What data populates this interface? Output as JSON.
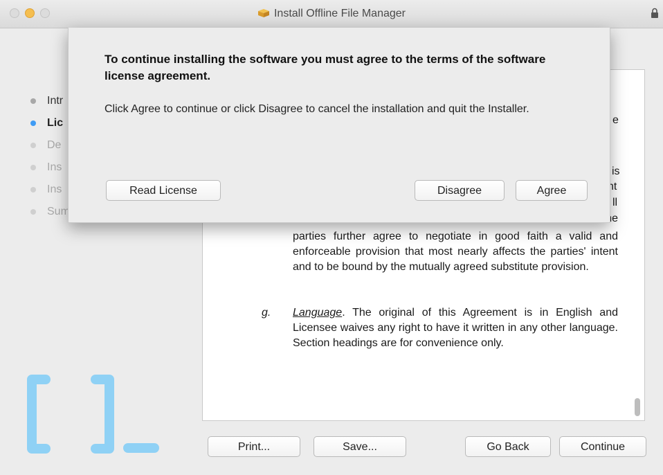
{
  "window": {
    "title": "Install Offline File Manager"
  },
  "sidebar": {
    "steps": [
      {
        "label": "Intr",
        "state": "done"
      },
      {
        "label": "Lic",
        "state": "current"
      },
      {
        "label": "De",
        "state": "pending"
      },
      {
        "label": "Ins",
        "state": "pending"
      },
      {
        "label": "Ins",
        "state": "pending"
      },
      {
        "label": "Summary",
        "state": "pending"
      }
    ]
  },
  "license": {
    "partial_lines": [
      "e",
      "is",
      "nt",
      "ll",
      "nevertheless remain in full force and effect. The"
    ],
    "clause_f_tail": "parties further agree to negotiate in good faith a valid and enforceable provision that most nearly affects the parties' intent and to be bound by the mutually agreed substitute provision.",
    "clause_g_marker": "g.",
    "clause_g_heading": "Language",
    "clause_g_text": ". The original of this Agreement is in English and Licensee waives any right to have it written in any other language. Section headings are for convenience only."
  },
  "buttons": {
    "print": "Print...",
    "save": "Save...",
    "go_back": "Go Back",
    "continue": "Continue"
  },
  "sheet": {
    "title": "To continue installing the software you must agree to the terms of the software license agreement.",
    "message": "Click Agree to continue or click Disagree to cancel the installation and quit the Installer.",
    "read_license": "Read License",
    "disagree": "Disagree",
    "agree": "Agree"
  },
  "colors": {
    "current_step": "#3f9cf5",
    "logo_accent": "#8fd1f5"
  },
  "icons": [
    "package-icon",
    "lock-icon",
    "app-logo"
  ]
}
